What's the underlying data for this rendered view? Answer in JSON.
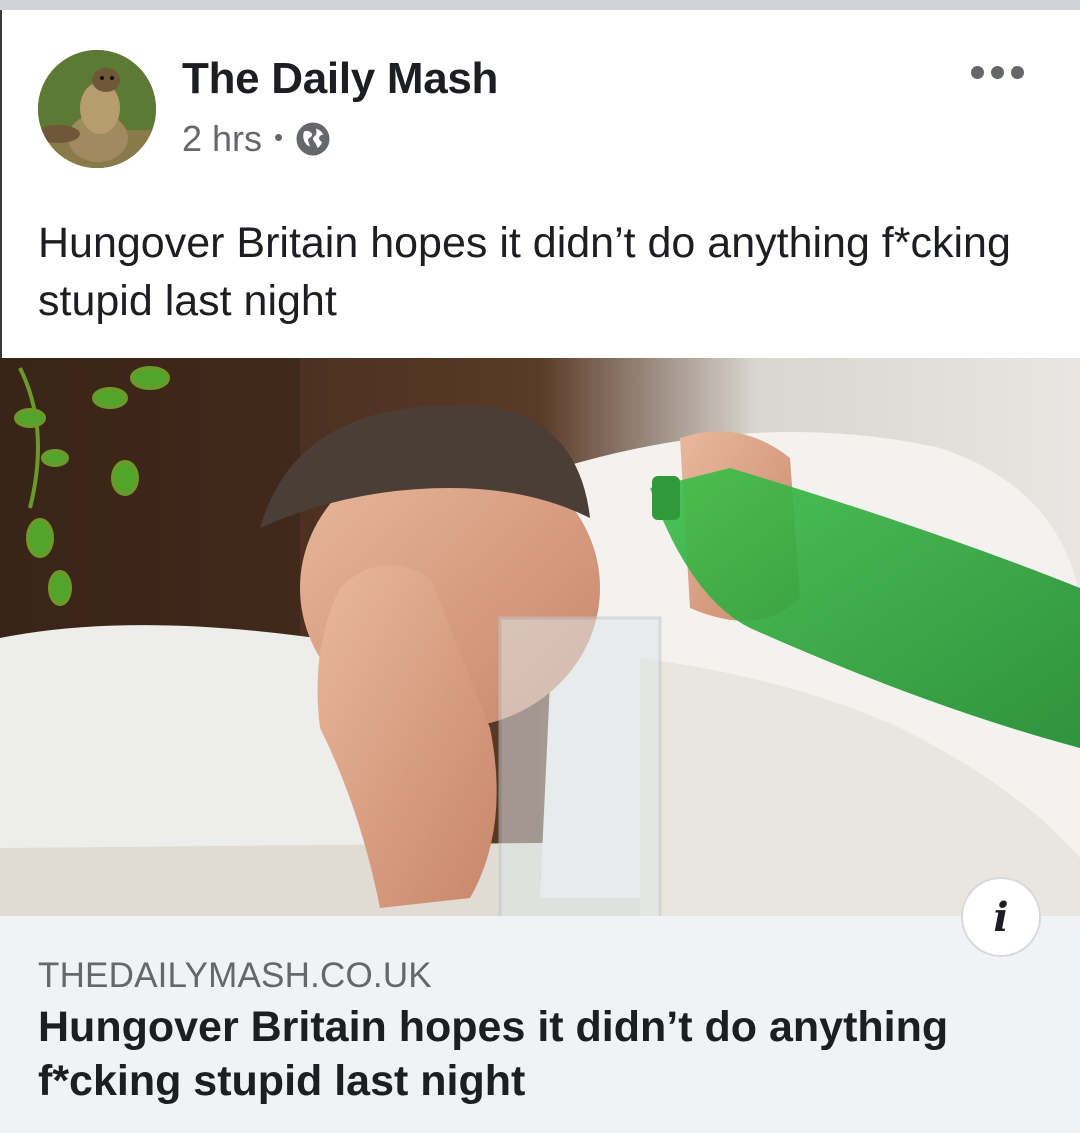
{
  "post": {
    "author": "The Daily Mash",
    "time": "2 hrs",
    "separator": "•",
    "privacy_icon": "globe-icon",
    "menu_icon": "more-horizontal-icon",
    "text": "Hungover Britain hopes it didn’t do anything f*cking stupid last night"
  },
  "link_preview": {
    "domain": "THEDAILYMASH.CO.UK",
    "title": "Hungover Britain hopes it didn’t do anything f*cking stupid last night",
    "info_label": "i",
    "info_icon": "info-icon"
  },
  "colors": {
    "primary_text": "#1c1e21",
    "secondary_text": "#65676b",
    "card_background": "#f0f2f5"
  }
}
